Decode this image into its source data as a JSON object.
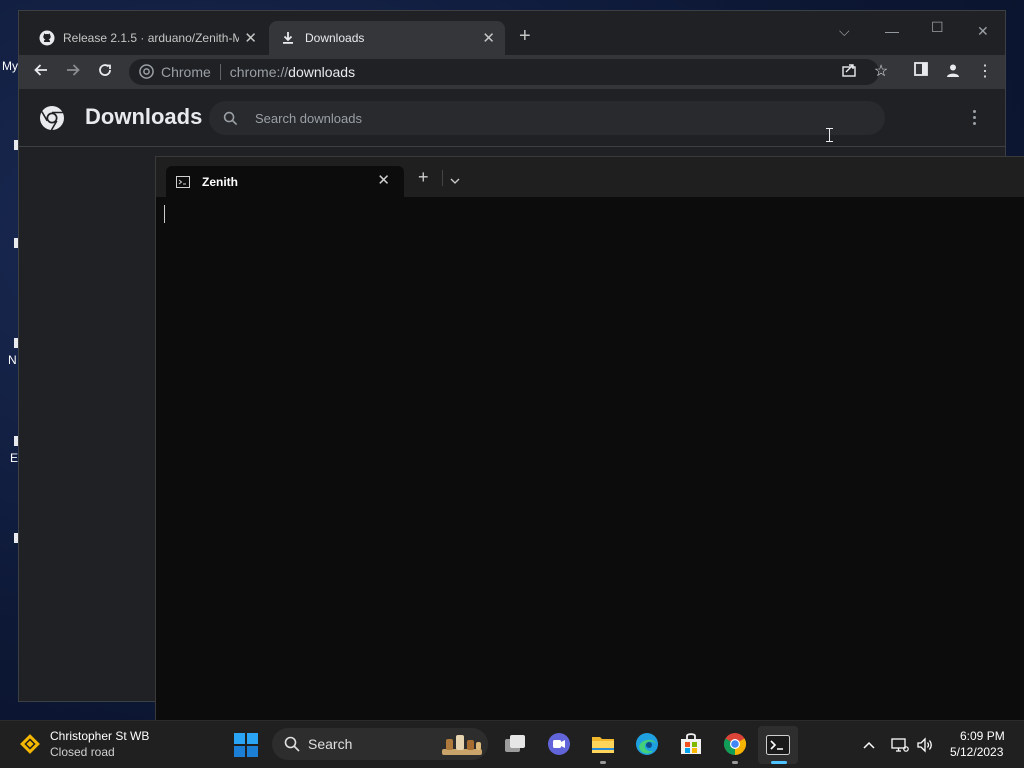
{
  "desktop": {
    "fragment_top": "My",
    "fragment_mid": "N",
    "fragment_low": "E"
  },
  "chrome": {
    "tabs": [
      {
        "label": "Release 2.1.5 · arduano/Zenith-M",
        "active": false
      },
      {
        "label": "Downloads",
        "active": true
      }
    ],
    "omnibox": {
      "site_label": "Chrome",
      "url_prefix": "chrome://",
      "url_path": "downloads"
    },
    "page": {
      "title": "Downloads",
      "search_placeholder": "Search downloads"
    }
  },
  "terminal": {
    "tab_label": "Zenith"
  },
  "taskbar": {
    "weather": {
      "title": "Christopher St WB",
      "subtitle": "Closed road"
    },
    "search_label": "Search",
    "clock": {
      "time": "6:09 PM",
      "date": "5/12/2023"
    }
  },
  "colors": {
    "chrome_bg": "#202124",
    "chrome_toolbar": "#35363a",
    "terminal_bg": "#0c0c0c",
    "taskbar_bg": "#202020",
    "accent": "#4cc2ff"
  }
}
